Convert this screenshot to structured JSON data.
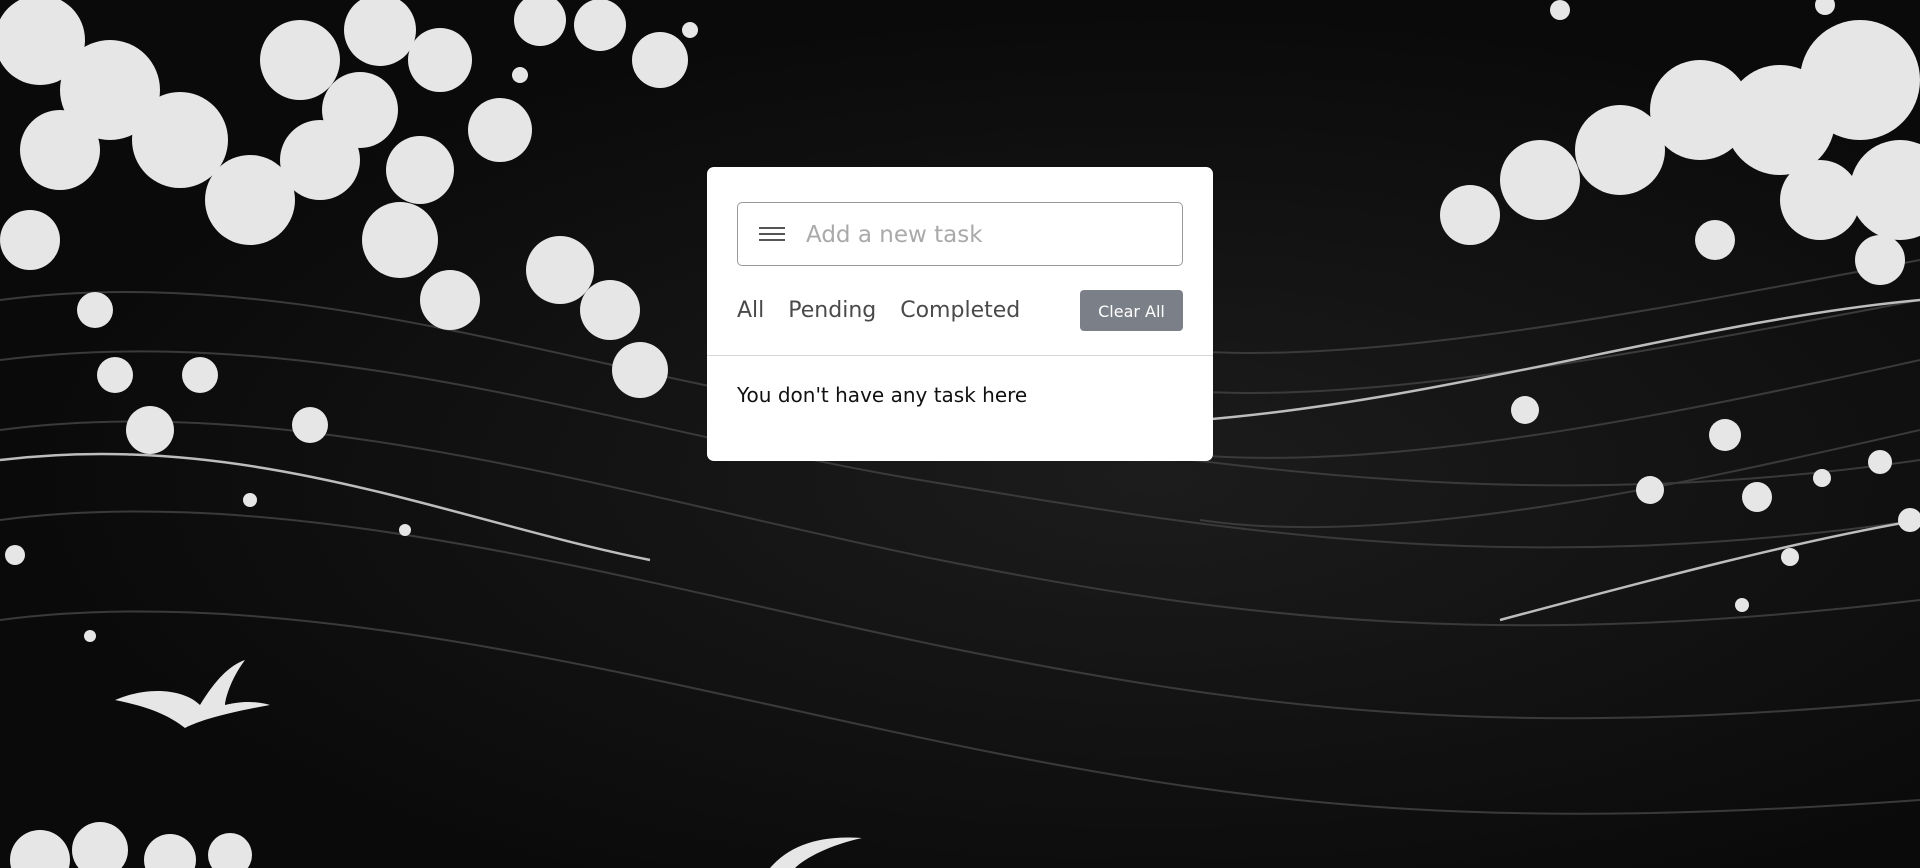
{
  "background": {
    "description_icon": "ocean-waves-art",
    "colors": {
      "dark": "#0a0a0a",
      "foam": "#e9e9e9"
    }
  },
  "todo": {
    "input": {
      "placeholder": "Add a new task",
      "value": ""
    },
    "menu_icon": "hamburger-icon",
    "filters": [
      "All",
      "Pending",
      "Completed"
    ],
    "clear_label": "Clear All",
    "empty_message": "You don't have any task here"
  },
  "colors": {
    "card": "#ffffff",
    "button": "#7b7f87",
    "button_text": "#ffffff"
  }
}
